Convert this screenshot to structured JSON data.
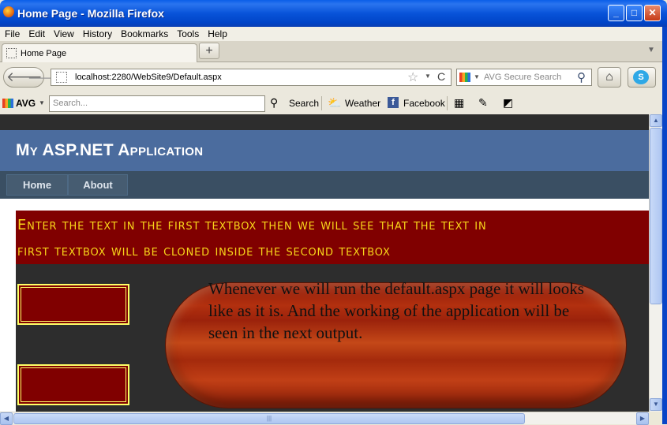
{
  "window": {
    "title": "Home Page - Mozilla Firefox",
    "minimize_glyph": "_",
    "maximize_glyph": "□",
    "close_glyph": "✕"
  },
  "menubar": [
    "File",
    "Edit",
    "View",
    "History",
    "Bookmarks",
    "Tools",
    "Help"
  ],
  "tabs": [
    {
      "label": "Home Page"
    }
  ],
  "new_tab_glyph": "+",
  "navbar": {
    "url": "localhost:2280/WebSite9/Default.aspx",
    "search_placeholder": "AVG Secure Search",
    "back_glyph": "🡐",
    "forward_glyph": "🡒",
    "reload_glyph": "C",
    "star_glyph": "☆",
    "home_glyph": "⌂",
    "skype_glyph": "S"
  },
  "avg_toolbar": {
    "logo": "AVG",
    "search_placeholder": "Search...",
    "search_button": "Search",
    "weather": "Weather",
    "facebook": "Facebook",
    "facebook_glyph": "f",
    "icons": [
      "search-icon",
      "weather-icon",
      "facebook-icon",
      "calculator-icon",
      "notepad-icon",
      "snapshot-icon"
    ]
  },
  "page": {
    "app_title": "My ASP.NET Application",
    "menu": [
      "Home",
      "About"
    ],
    "banner_lines": [
      "Enter the text in the first textbox then we will see that the text in",
      "first textbox will be cloned inside the second textbox"
    ],
    "textbox1_value": "",
    "textbox2_value": "",
    "pill_text": "Whenever we will run the default.aspx page it will looks like as it is. And the working of the application will be seen in the next output."
  },
  "colors": {
    "header_blue": "#4b6c9e",
    "menu_bar": "#3a4f63",
    "banner_bg": "#800000",
    "banner_text": "#f8d51a",
    "content_bg": "#2d2d2d",
    "textbox_border": "#ffff66"
  }
}
